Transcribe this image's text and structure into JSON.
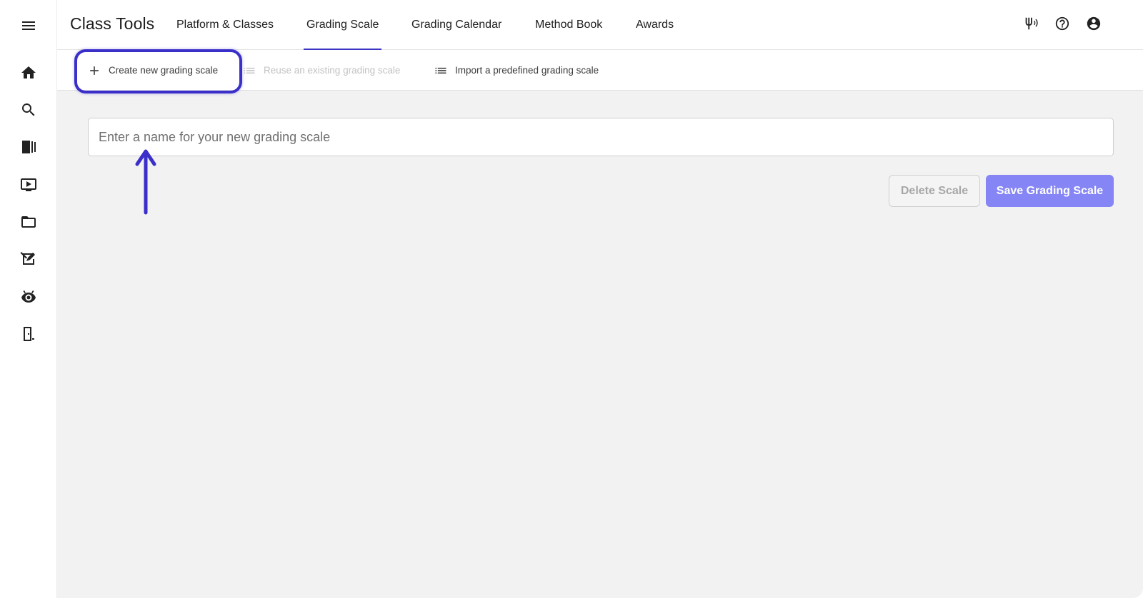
{
  "app": {
    "title": "Class Tools"
  },
  "tabs": [
    {
      "label": "Platform & Classes",
      "active": false
    },
    {
      "label": "Grading Scale",
      "active": true
    },
    {
      "label": "Grading Calendar",
      "active": false
    },
    {
      "label": "Method Book",
      "active": false
    },
    {
      "label": "Awards",
      "active": false
    }
  ],
  "header_icons": [
    "tuning-fork-icon",
    "help-icon",
    "account-icon"
  ],
  "sidebar": {
    "icons": [
      "menu-icon",
      "home-icon",
      "search-icon",
      "library-icon",
      "video-icon",
      "folder-icon",
      "assignment-icon",
      "listen-icon",
      "exit-icon"
    ]
  },
  "subbar": {
    "create_label": "Create new grading scale",
    "reuse_label": "Reuse an existing grading scale",
    "import_label": "Import a predefined grading scale"
  },
  "form": {
    "name_placeholder": "Enter a name for your new grading scale",
    "name_value": ""
  },
  "buttons": {
    "delete_label": "Delete Scale",
    "save_label": "Save Grading Scale"
  },
  "colors": {
    "accent": "#3c35c4",
    "annotation": "#3a2fc9",
    "save_button": "#8585f5",
    "main_background": "#f2f2f2"
  }
}
